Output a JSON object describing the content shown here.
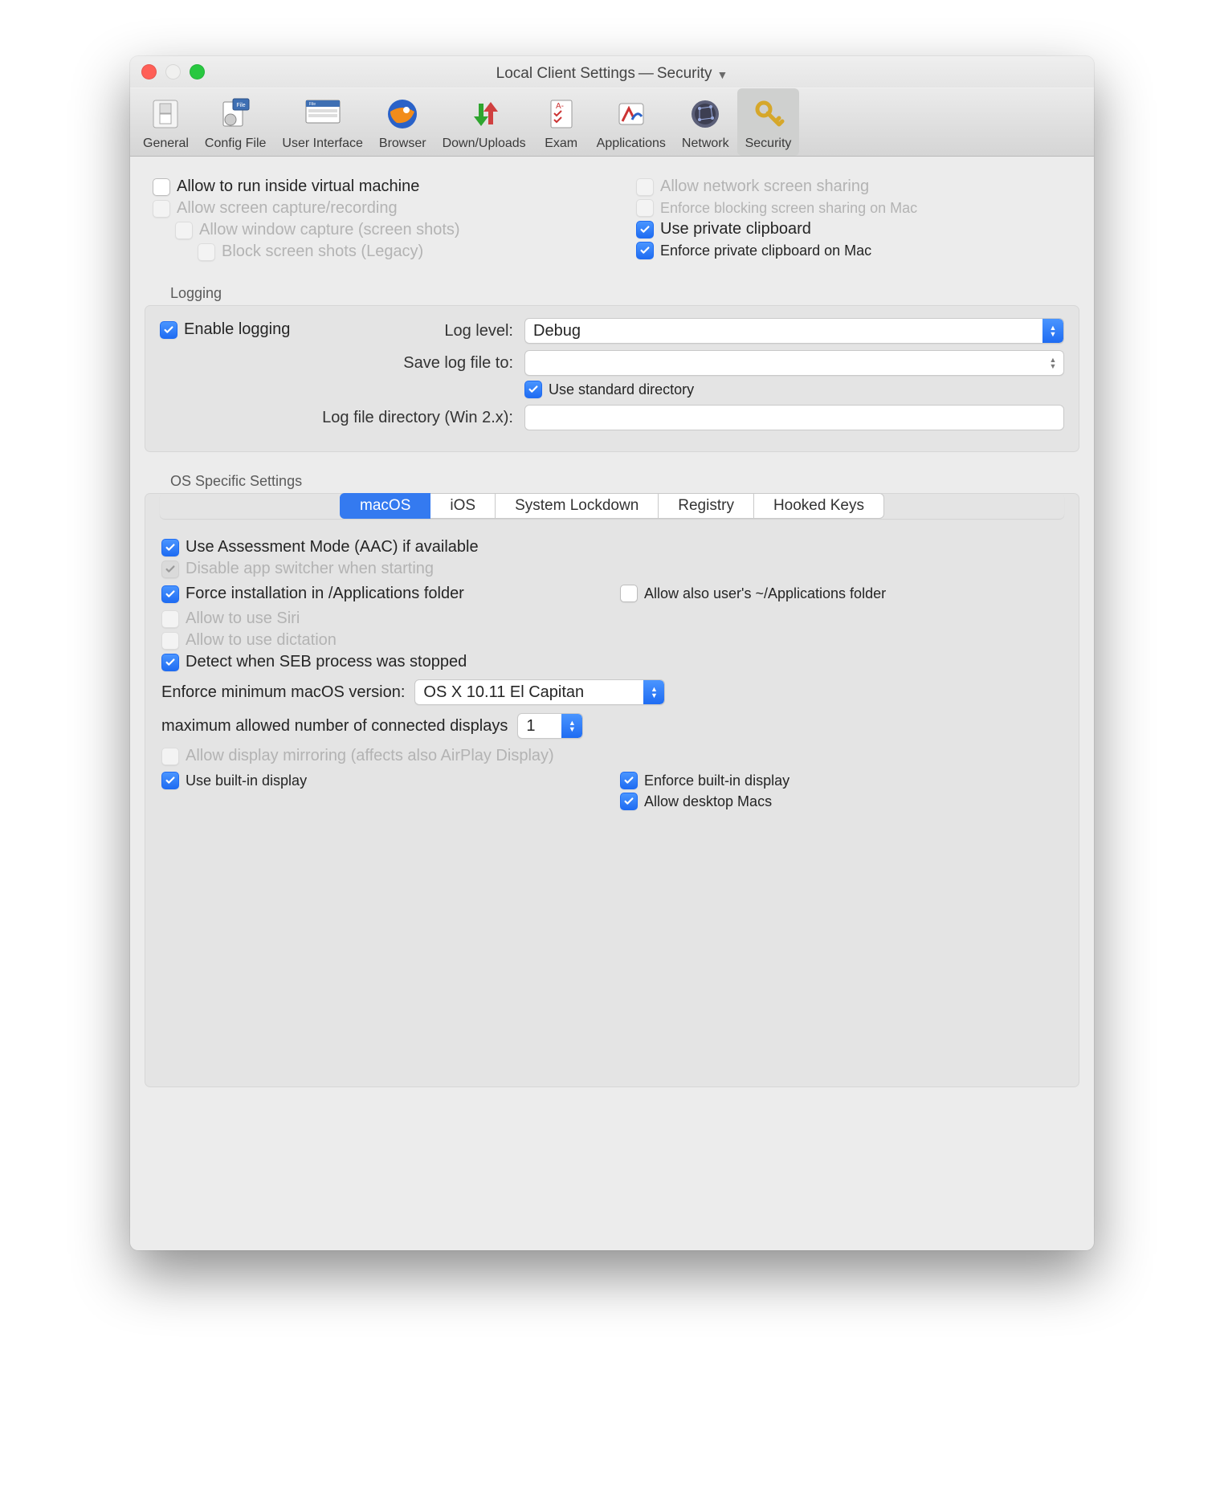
{
  "title": {
    "left": "Local Client Settings",
    "sep": "—",
    "right": "Security"
  },
  "toolbar": [
    {
      "id": "general",
      "label": "General"
    },
    {
      "id": "config",
      "label": "Config File"
    },
    {
      "id": "ui",
      "label": "User Interface"
    },
    {
      "id": "browser",
      "label": "Browser"
    },
    {
      "id": "updown",
      "label": "Down/Uploads"
    },
    {
      "id": "exam",
      "label": "Exam"
    },
    {
      "id": "apps",
      "label": "Applications"
    },
    {
      "id": "network",
      "label": "Network"
    },
    {
      "id": "security",
      "label": "Security"
    }
  ],
  "selected_toolbar": "security",
  "top_left": {
    "allow_vm": "Allow to run inside virtual machine",
    "allow_capture": "Allow screen capture/recording",
    "allow_window_capture": "Allow window capture (screen shots)",
    "block_screenshots": "Block screen shots (Legacy)"
  },
  "top_right": {
    "allow_net_share": "Allow network screen sharing",
    "enforce_block_share": "Enforce blocking screen sharing on Mac",
    "use_private_cb": "Use private clipboard",
    "enforce_private_cb": "Enforce private clipboard on Mac"
  },
  "logging": {
    "group": "Logging",
    "enable": "Enable logging",
    "loglevel_label": "Log level:",
    "loglevel_value": "Debug",
    "save_to_label": "Save log file to:",
    "save_to_value": "",
    "use_std_dir": "Use standard directory",
    "logdir_win_label": "Log file directory (Win 2.x):",
    "logdir_win_value": ""
  },
  "os": {
    "group": "OS Specific Settings",
    "tabs": [
      "macOS",
      "iOS",
      "System Lockdown",
      "Registry",
      "Hooked Keys"
    ],
    "selected_tab": "macOS",
    "macos": {
      "aac": "Use Assessment Mode (AAC) if available",
      "disable_switcher": "Disable app switcher when starting",
      "force_install": "Force installation in /Applications folder",
      "allow_user_apps": "Allow also user's ~/Applications folder",
      "allow_siri": "Allow to use Siri",
      "allow_dictation": "Allow to use dictation",
      "detect_stopped": "Detect when SEB process was stopped",
      "min_ver_label": "Enforce minimum macOS version:",
      "min_ver_value": "OS X 10.11 El Capitan",
      "max_displays_label": "maximum allowed number of connected displays",
      "max_displays_value": "1",
      "allow_mirror": "Allow display mirroring (affects also AirPlay Display)",
      "use_builtin": "Use built-in display",
      "enforce_builtin": "Enforce built-in display",
      "allow_desktop": "Allow desktop Macs"
    }
  }
}
